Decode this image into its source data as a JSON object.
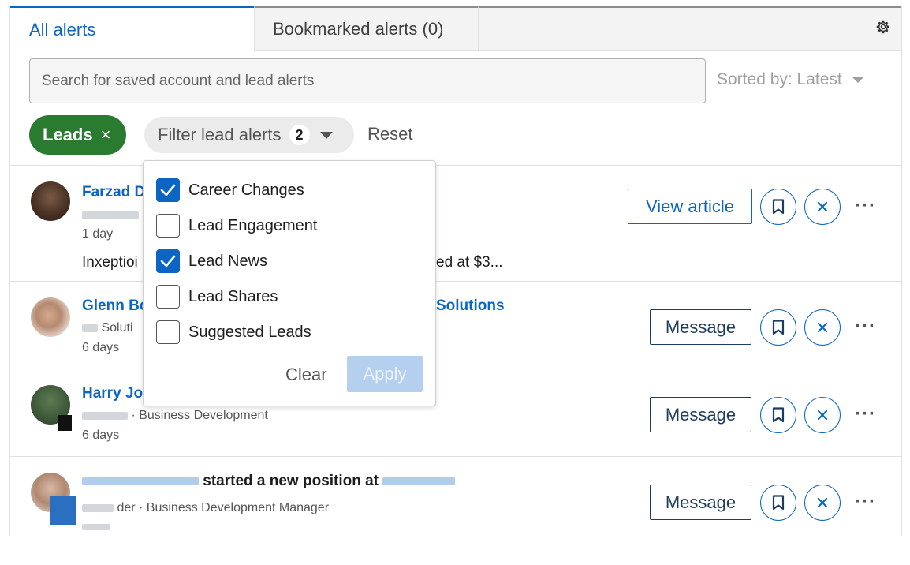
{
  "tabs": {
    "all": "All alerts",
    "bookmarked": "Bookmarked alerts (0)"
  },
  "search": {
    "placeholder": "Search for saved account and lead alerts"
  },
  "sort": {
    "label": "Sorted by: Latest"
  },
  "filters": {
    "leads_chip": "Leads",
    "leads_remove": "×",
    "filter_label": "Filter lead alerts",
    "filter_count": "2",
    "reset": "Reset"
  },
  "dropdown": {
    "options": [
      {
        "label": "Career Changes",
        "checked": true
      },
      {
        "label": "Lead Engagement",
        "checked": false
      },
      {
        "label": "Lead News",
        "checked": true
      },
      {
        "label": "Lead Shares",
        "checked": false
      },
      {
        "label": "Suggested Leads",
        "checked": false
      }
    ],
    "clear": "Clear",
    "apply": "Apply"
  },
  "rows": [
    {
      "name": "Farzad D",
      "time": "1 day",
      "snippet_start": "Inxeptioi",
      "snippet_end": "ed at $3...",
      "action": "View article"
    },
    {
      "name": "Glenn Bc",
      "name_tail": "Solutions",
      "sub": "Soluti",
      "time": "6 days",
      "action": "Message"
    },
    {
      "name": "Harry Jo",
      "sub": "· Business Development",
      "time": "6 days",
      "action": "Message"
    },
    {
      "headline": "started a new position at",
      "sub": "der · Business Development Manager",
      "action": "Message"
    }
  ],
  "icons": {
    "more": "···",
    "remove": "×"
  },
  "colors": {
    "accent": "#0a66c2",
    "leads_chip": "#2a7a30",
    "apply_disabled": "#b5d0ee"
  }
}
